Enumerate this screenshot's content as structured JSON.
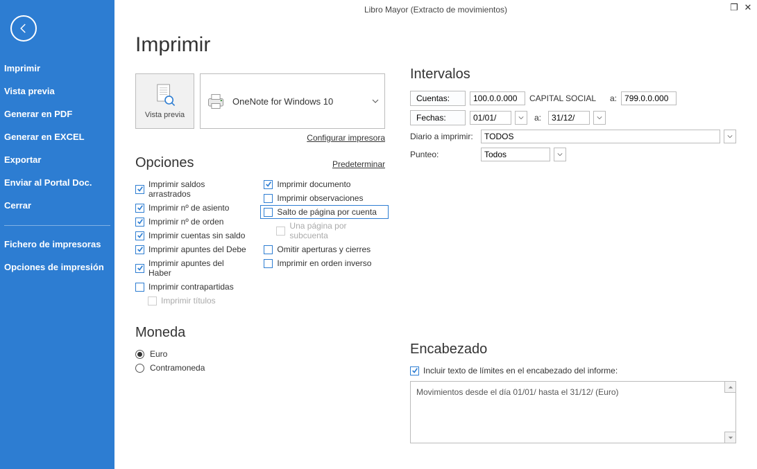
{
  "window_title": "Libro Mayor (Extracto de movimientos)",
  "sidebar": {
    "items": [
      "Imprimir",
      "Vista previa",
      "Generar en PDF",
      "Generar en EXCEL",
      "Exportar",
      "Enviar al Portal Doc.",
      "Cerrar"
    ],
    "items2": [
      "Fichero de impresoras",
      "Opciones de impresión"
    ]
  },
  "page_title": "Imprimir",
  "preview_label": "Vista previa",
  "printer_name": "OneNote for Windows 10",
  "links": {
    "config": "Configurar impresora",
    "default": "Predeterminar"
  },
  "sections": {
    "options": "Opciones",
    "currency": "Moneda",
    "intervals": "Intervalos",
    "header": "Encabezado"
  },
  "options_left": [
    {
      "label": "Imprimir saldos arrastrados",
      "checked": true
    },
    {
      "label": "Imprimir nº de asiento",
      "checked": true
    },
    {
      "label": "Imprimir nº de orden",
      "checked": true
    },
    {
      "label": "Imprimir cuentas sin saldo",
      "checked": true
    },
    {
      "label": "Imprimir apuntes del Debe",
      "checked": true
    },
    {
      "label": "Imprimir apuntes del Haber",
      "checked": true
    },
    {
      "label": "Imprimir contrapartidas",
      "checked": false
    },
    {
      "label": "Imprimir títulos",
      "checked": false,
      "disabled": true,
      "indent": true
    }
  ],
  "options_right": [
    {
      "label": "Imprimir documento",
      "checked": true
    },
    {
      "label": "Imprimir observaciones",
      "checked": false
    },
    {
      "label": "Salto de página por cuenta",
      "checked": false,
      "highlight": true
    },
    {
      "label": "Una página por subcuenta",
      "checked": false,
      "disabled": true,
      "indent": true
    },
    {
      "label": "Omitir aperturas y cierres",
      "checked": false
    },
    {
      "label": "Imprimir en orden inverso",
      "checked": false
    }
  ],
  "currency": {
    "euro": "Euro",
    "contra": "Contramoneda",
    "selected": "euro"
  },
  "intervals": {
    "accounts_label": "Cuentas:",
    "acc_from": "100.0.0.000",
    "acc_name": "CAPITAL SOCIAL",
    "to": "a:",
    "acc_to": "799.0.0.000",
    "dates_label": "Fechas:",
    "date_from": "01/01/",
    "date_to": "31/12/",
    "diary_label": "Diario a imprimir:",
    "diary_value": "TODOS",
    "punteo_label": "Punteo:",
    "punteo_value": "Todos"
  },
  "header_opt": {
    "include": "Incluir texto de límites en el encabezado del informe:",
    "text": "Movimientos desde el día 01/01/       hasta el 31/12/        (Euro)"
  }
}
